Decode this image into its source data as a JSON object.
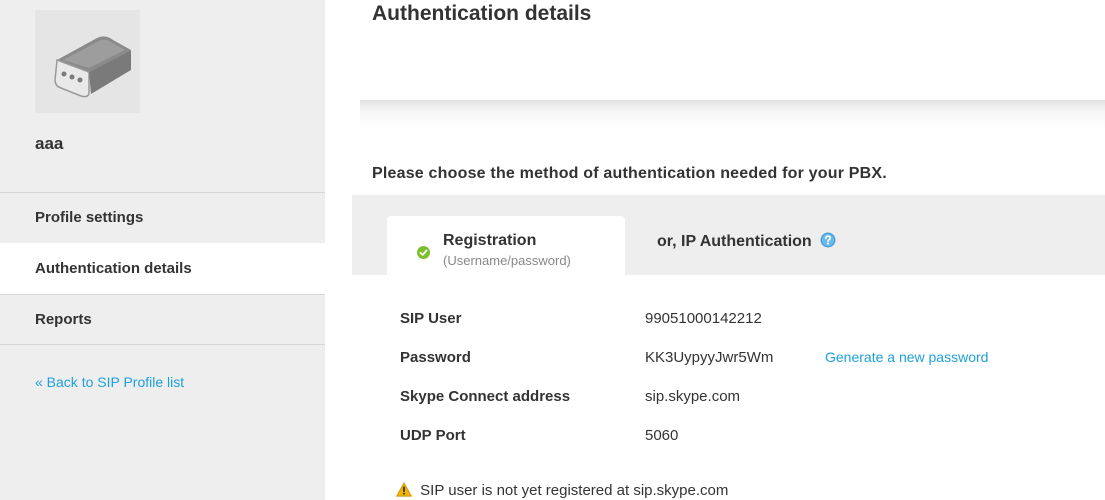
{
  "sidebar": {
    "device_icon": "sip-device-icon",
    "profile_name": "aaa",
    "nav": [
      {
        "label": "Profile settings",
        "active": false
      },
      {
        "label": "Authentication details",
        "active": true
      },
      {
        "label": "Reports",
        "active": false
      }
    ],
    "back_link": "« Back to SIP Profile list"
  },
  "main": {
    "title": "Authentication details",
    "subtitle": "Please choose the method of authentication needed for your PBX.",
    "tabs": {
      "registration": {
        "title": "Registration",
        "subtitle": "(Username/password)",
        "icon": "check-icon"
      },
      "ip": {
        "label": "or, IP Authentication",
        "icon": "help-icon"
      }
    },
    "details": {
      "sip_user": {
        "label": "SIP User",
        "value": "99051000142212"
      },
      "password": {
        "label": "Password",
        "value": "KK3UypyyJwr5Wm",
        "link": "Generate a new password"
      },
      "address": {
        "label": "Skype Connect address",
        "value": "sip.skype.com"
      },
      "udp_port": {
        "label": "UDP Port",
        "value": "5060"
      }
    },
    "warning": {
      "icon": "warning-icon",
      "text": "SIP user is not yet registered at sip.skype.com"
    }
  },
  "colors": {
    "link": "#1ea0dc",
    "check": "#7cbf2a",
    "warning": "#f0b400",
    "sidebar_bg": "#eeeeee"
  }
}
